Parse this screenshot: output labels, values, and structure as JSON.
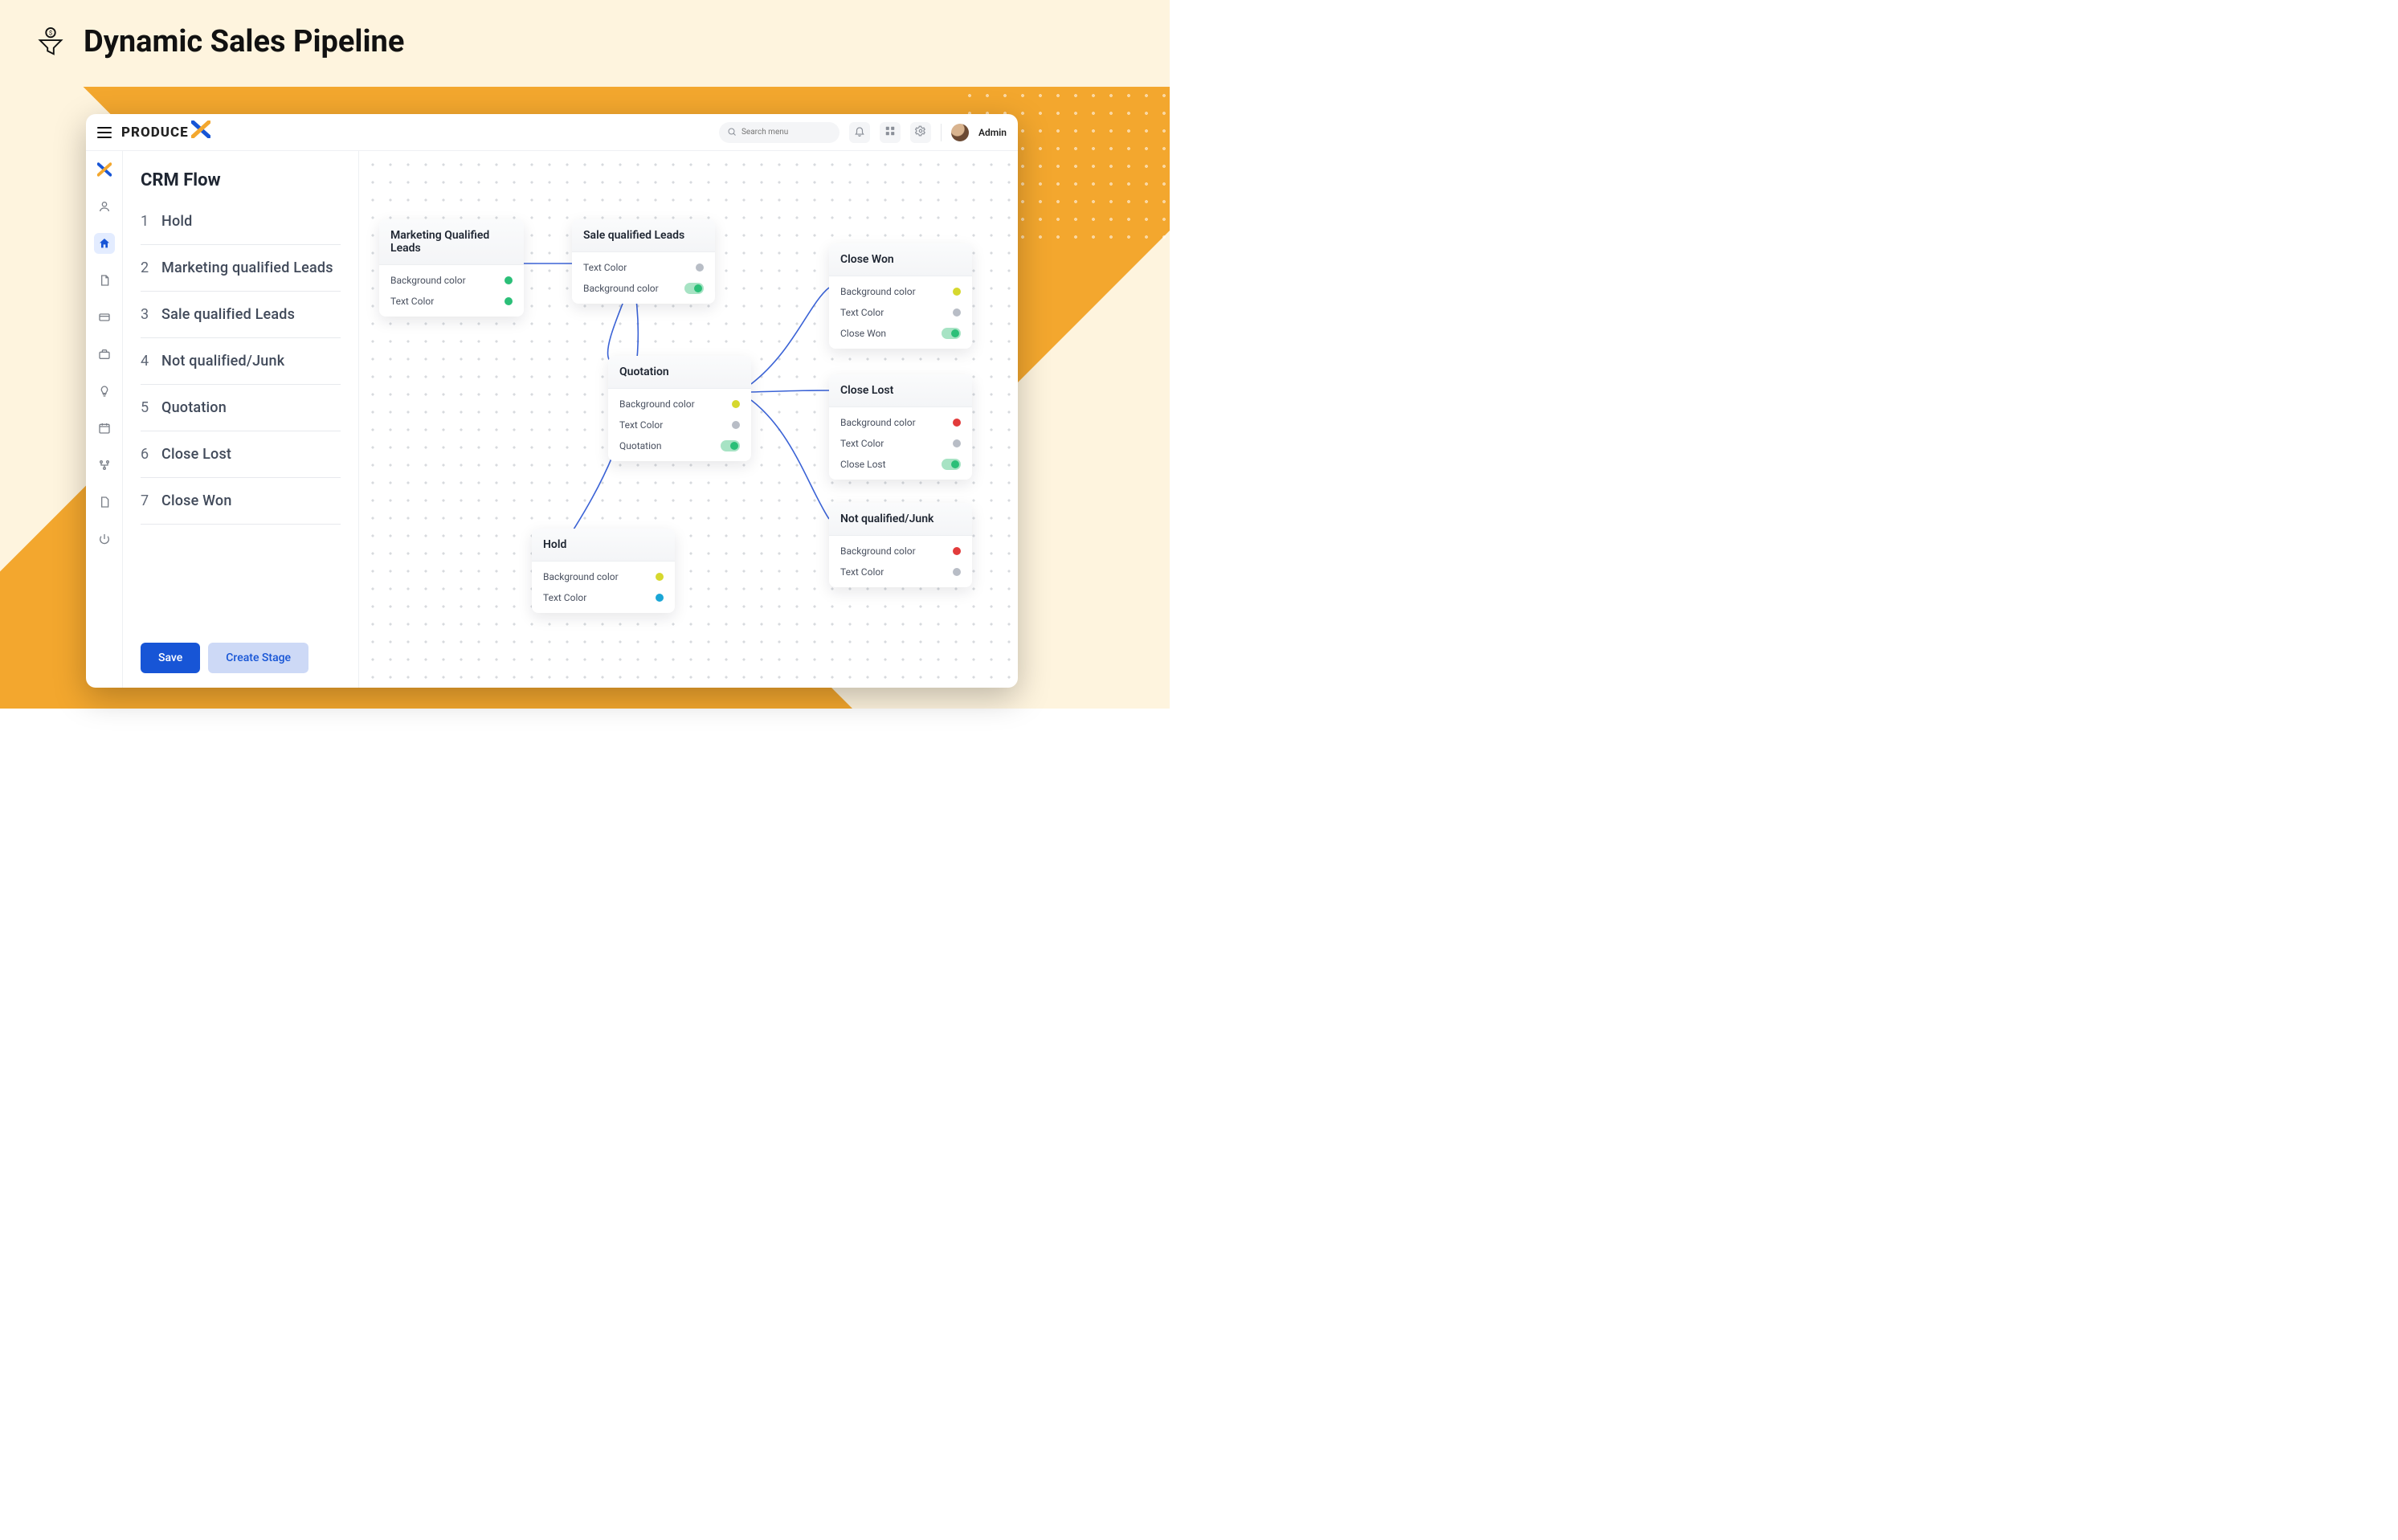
{
  "hero": {
    "title": "Dynamic Sales Pipeline"
  },
  "header": {
    "brand": "PRODUCE",
    "search_placeholder": "Search menu",
    "user": "Admin"
  },
  "sidepanel": {
    "title": "CRM Flow",
    "stages": [
      {
        "n": "1",
        "label": "Hold"
      },
      {
        "n": "2",
        "label": "Marketing qualified Leads"
      },
      {
        "n": "3",
        "label": "Sale qualified Leads"
      },
      {
        "n": "4",
        "label": "Not qualified/Junk"
      },
      {
        "n": "5",
        "label": "Quotation"
      },
      {
        "n": "6",
        "label": "Close Lost"
      },
      {
        "n": "7",
        "label": "Close Won"
      }
    ],
    "actions": {
      "save": "Save",
      "create": "Create Stage"
    }
  },
  "nodes": {
    "mql": {
      "title": "Marketing Qualified Leads",
      "p0": "Background color",
      "p1": "Text Color"
    },
    "sql": {
      "title": "Sale qualified Leads",
      "p0": "Text Color",
      "p1": "Background color"
    },
    "cwon": {
      "title": "Close Won",
      "p0": "Background color",
      "p1": "Text Color",
      "p2": "Close Won"
    },
    "quot": {
      "title": "Quotation",
      "p0": "Background color",
      "p1": "Text Color",
      "p2": "Quotation"
    },
    "clos": {
      "title": "Close Lost",
      "p0": "Background color",
      "p1": "Text Color",
      "p2": "Close Lost"
    },
    "junk": {
      "title": "Not qualified/Junk",
      "p0": "Background color",
      "p1": "Text Color"
    },
    "hold": {
      "title": "Hold",
      "p0": "Background color",
      "p1": "Text Color"
    }
  }
}
